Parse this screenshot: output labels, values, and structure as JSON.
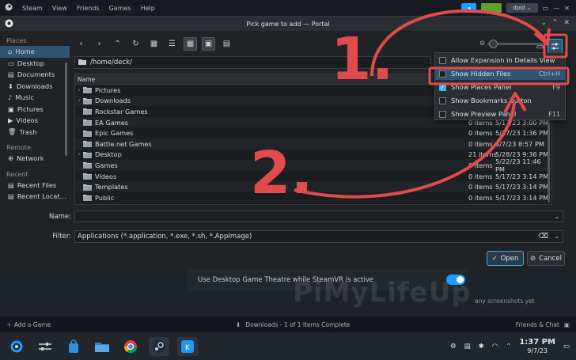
{
  "steam": {
    "menu": [
      "Steam",
      "View",
      "Friends",
      "Games",
      "Help"
    ],
    "username": "dpid",
    "setting_row": "Use Desktop Game Theatre while SteamVR is active",
    "side_text": "any screenshots yet",
    "watermark": "PiMyLifeUp",
    "add_game": "Add a Game",
    "downloads": "Downloads - 1 of 1 Items Complete",
    "friends_chat": "Friends & Chat"
  },
  "dialog": {
    "title": "Pick game to add — Portal",
    "path": "/home/deck/",
    "places_header": "Places",
    "places": [
      {
        "label": "Home",
        "icon": "home-icon",
        "selected": true
      },
      {
        "label": "Desktop",
        "icon": "desktop-icon"
      },
      {
        "label": "Documents",
        "icon": "documents-icon"
      },
      {
        "label": "Downloads",
        "icon": "download-icon"
      },
      {
        "label": "Music",
        "icon": "music-icon"
      },
      {
        "label": "Pictures",
        "icon": "pictures-icon"
      },
      {
        "label": "Videos",
        "icon": "videos-icon"
      },
      {
        "label": "Trash",
        "icon": "trash-icon"
      }
    ],
    "remote_header": "Remote",
    "remote": [
      {
        "label": "Network",
        "icon": "network-icon"
      }
    ],
    "recent_header": "Recent",
    "recent": [
      {
        "label": "Recent Files",
        "icon": "recent-files-icon"
      },
      {
        "label": "Recent Locat…",
        "icon": "recent-locations-icon"
      }
    ],
    "column_name": "Name",
    "files": [
      {
        "name": "Pictures",
        "expand": true,
        "count": "",
        "date": ""
      },
      {
        "name": "Downloads",
        "expand": true,
        "count": "",
        "date": ""
      },
      {
        "name": "Rockstar Games",
        "expand": false,
        "count": "",
        "date": ""
      },
      {
        "name": "EA Games",
        "expand": false,
        "count": "0 items",
        "date": "5/17/23 3:00 PM"
      },
      {
        "name": "Epic Games",
        "expand": false,
        "count": "0 items",
        "date": "5/17/23 1:36 PM"
      },
      {
        "name": "Battle.net Games",
        "expand": false,
        "count": "0 items",
        "date": "6/7/23 8:57 PM"
      },
      {
        "name": "Desktop",
        "expand": true,
        "count": "21 items",
        "date": "5/28/23 9:36 PM"
      },
      {
        "name": "Games",
        "expand": false,
        "count": "0 items",
        "date": "5/22/23 11:46 PM"
      },
      {
        "name": "Videos",
        "expand": false,
        "count": "0 items",
        "date": "5/17/23 3:14 PM"
      },
      {
        "name": "Templates",
        "expand": false,
        "count": "0 items",
        "date": "5/17/23 3:14 PM"
      },
      {
        "name": "Public",
        "expand": false,
        "count": "0 items",
        "date": "5/17/23 3:14 PM"
      }
    ],
    "name_label": "Name:",
    "name_value": "",
    "filter_label": "Filter:",
    "filter_value": "Applications (*.application, *.exe, *.sh, *.AppImage)",
    "open_label": "Open",
    "cancel_label": "Cancel"
  },
  "context_menu": [
    {
      "label": "Allow Expansion in Details View",
      "checked": false,
      "shortcut": ""
    },
    {
      "label": "Show Hidden Files",
      "checked": false,
      "shortcut": "Ctrl+H",
      "highlighted": true
    },
    {
      "label": "Show Places Panel",
      "checked": true,
      "shortcut": "F9"
    },
    {
      "label": "Show Bookmarks Button",
      "checked": false,
      "shortcut": ""
    },
    {
      "label": "Show Preview Panel",
      "checked": false,
      "shortcut": "F11"
    }
  ],
  "annotations": {
    "step1": "1.",
    "step2": "2."
  },
  "taskbar": {
    "time": "1:37 PM",
    "date": "9/7/23"
  },
  "colors": {
    "accent": "#3daee9",
    "annotation": "#e24b4b",
    "selection": "#2f5573"
  }
}
